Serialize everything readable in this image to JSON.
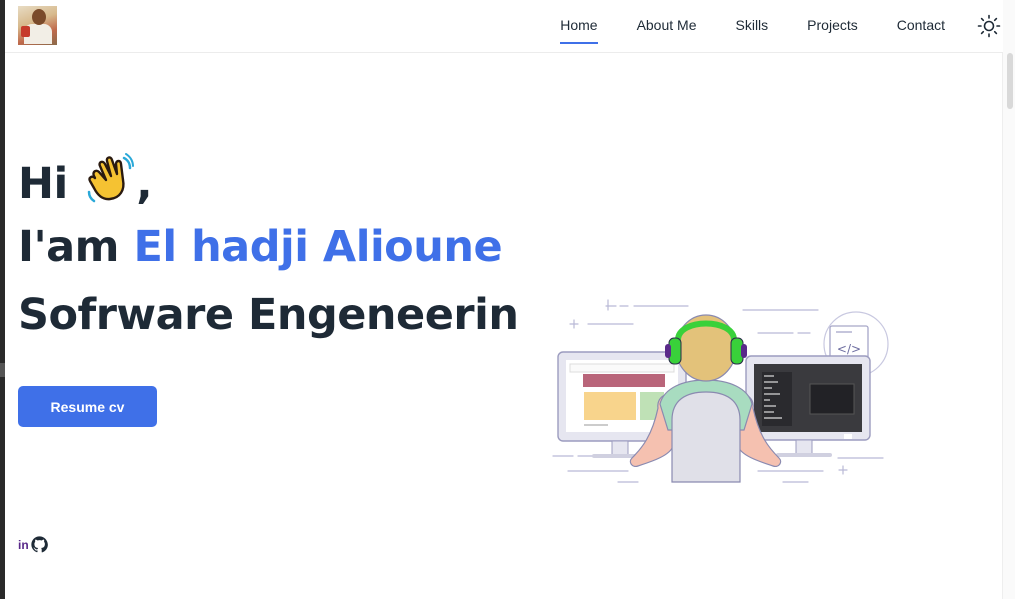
{
  "nav": {
    "items": [
      {
        "label": "Home",
        "active": true
      },
      {
        "label": "About Me"
      },
      {
        "label": "Skills"
      },
      {
        "label": "Projects"
      },
      {
        "label": "Contact"
      }
    ],
    "theme_icon": "sun-icon"
  },
  "hero": {
    "greeting": "Hi",
    "greeting_suffix": ",",
    "wave_icon": "waving-hand-icon",
    "intro_prefix": "I'am",
    "name": "El hadji Alioune",
    "role": "Sofrware Engeneering"
  },
  "actions": {
    "resume_label": "Resume cv"
  },
  "socials": {
    "linkedin_label": "in",
    "github_icon": "github-icon"
  },
  "colors": {
    "accent": "#3f70e8",
    "text": "#1e2a36"
  }
}
